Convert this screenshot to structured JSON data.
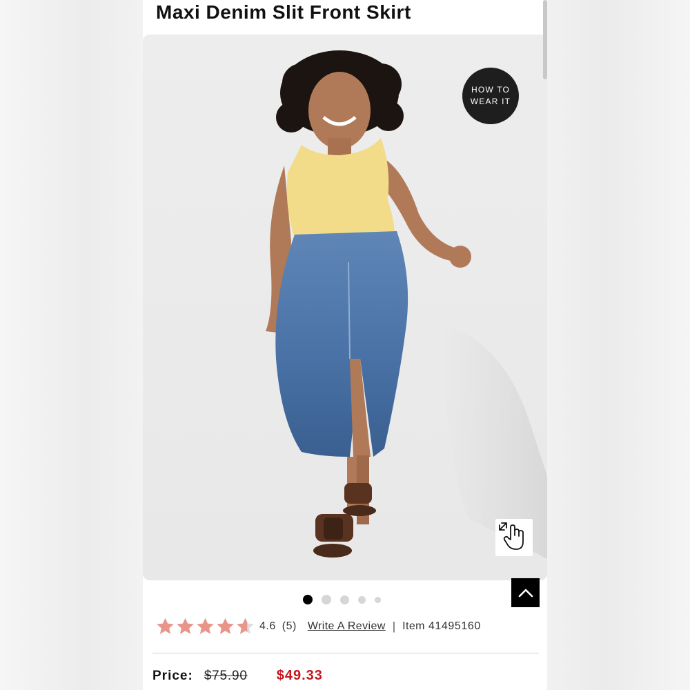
{
  "product": {
    "title": "Maxi Denim Slit Front Skirt"
  },
  "gallery": {
    "how_to_wear_line1": "HOW TO",
    "how_to_wear_line2": "WEAR IT",
    "zoom_icon": "hand-pointer-expand-icon",
    "back_to_top_icon": "chevron-up-icon",
    "dot_count": 5,
    "active_dot": 1
  },
  "rating": {
    "stars_value": 4.6,
    "value_text": "4.6",
    "count_text": "(5)",
    "write_review_label": "Write A Review",
    "separator": "|",
    "item_label": "Item",
    "item_number": "41495160",
    "star_color": "#e8958a"
  },
  "price": {
    "label": "Price:",
    "original": "$75.90",
    "sale": "$49.33",
    "sale_color": "#c4161c"
  }
}
